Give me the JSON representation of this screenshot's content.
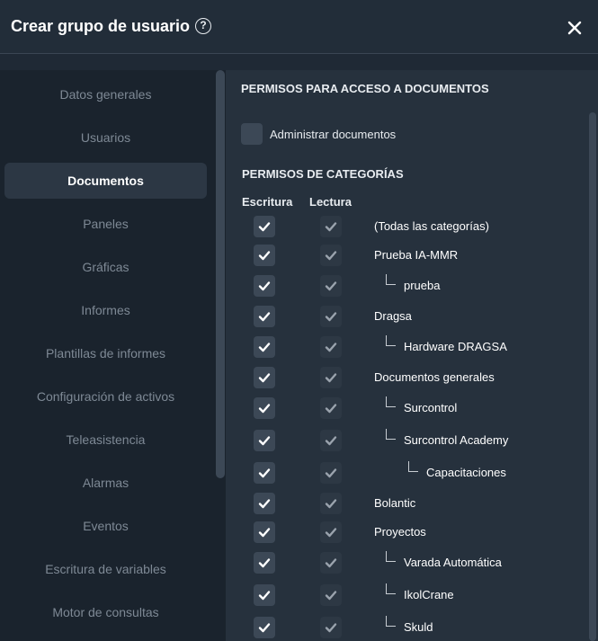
{
  "header": {
    "title": "Crear grupo de usuario",
    "help_icon": "question-circle-icon",
    "close_icon": "close-x-icon"
  },
  "sidebar": {
    "items": [
      {
        "label": "Datos generales",
        "active": false
      },
      {
        "label": "Usuarios",
        "active": false
      },
      {
        "label": "Documentos",
        "active": true
      },
      {
        "label": "Paneles",
        "active": false
      },
      {
        "label": "Gráficas",
        "active": false
      },
      {
        "label": "Informes",
        "active": false
      },
      {
        "label": "Plantillas de informes",
        "active": false
      },
      {
        "label": "Configuración de activos",
        "active": false
      },
      {
        "label": "Teleasistencia",
        "active": false
      },
      {
        "label": "Alarmas",
        "active": false
      },
      {
        "label": "Eventos",
        "active": false
      },
      {
        "label": "Escritura de variables",
        "active": false
      },
      {
        "label": "Motor de consultas",
        "active": false
      }
    ]
  },
  "main": {
    "section_docs": "PERMISOS PARA ACCESO A DOCUMENTOS",
    "admin_label": "Administrar documentos",
    "admin_checked": false,
    "section_cats": "PERMISOS DE CATEGORÍAS",
    "col_write": "Escritura",
    "col_read": "Lectura",
    "categories": [
      {
        "label": "(Todas las categorías)",
        "level": 0,
        "write": true,
        "read": true
      },
      {
        "label": "Prueba IA-MMR",
        "level": 0,
        "write": true,
        "read": true
      },
      {
        "label": "prueba",
        "level": 1,
        "write": true,
        "read": true
      },
      {
        "label": "Dragsa",
        "level": 0,
        "write": true,
        "read": true
      },
      {
        "label": "Hardware DRAGSA",
        "level": 1,
        "write": true,
        "read": true
      },
      {
        "label": "Documentos generales",
        "level": 0,
        "write": true,
        "read": true
      },
      {
        "label": "Surcontrol",
        "level": 1,
        "write": true,
        "read": true
      },
      {
        "label": "Surcontrol Academy",
        "level": 1,
        "write": true,
        "read": true
      },
      {
        "label": "Capacitaciones",
        "level": 2,
        "write": true,
        "read": true
      },
      {
        "label": "Bolantic",
        "level": 0,
        "write": true,
        "read": true
      },
      {
        "label": "Proyectos",
        "level": 0,
        "write": true,
        "read": true
      },
      {
        "label": "Varada Automática",
        "level": 1,
        "write": true,
        "read": true
      },
      {
        "label": "IkolCrane",
        "level": 1,
        "write": true,
        "read": true
      },
      {
        "label": "Skuld",
        "level": 1,
        "write": true,
        "read": true
      }
    ]
  },
  "colors": {
    "background": "#1f2935",
    "sidebar": "#1a232d",
    "main": "#26313d",
    "checkbox_write": "#3c4856",
    "checkbox_read": "#2d3844",
    "check_write": "#ffffff",
    "check_read": "#9aa3ad"
  }
}
